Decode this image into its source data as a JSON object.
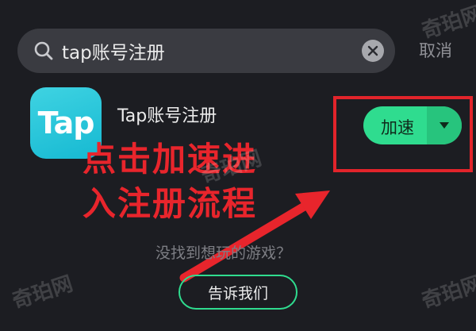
{
  "search": {
    "value": "tap账号注册",
    "cancel_label": "取消"
  },
  "app": {
    "icon_text": "Tap",
    "name": "Tap账号注册",
    "accelerate_label": "加速"
  },
  "annotation": {
    "line1": "点击加速进",
    "line2": "入注册流程"
  },
  "not_found": {
    "text": "没找到想玩的游戏？",
    "button_label": "告诉我们"
  },
  "watermark": {
    "text": "奇珀网"
  },
  "colors": {
    "background": "#1c1d22",
    "accent_green": "#2fdc8f",
    "annotation_red": "#e8252c",
    "app_icon_cyan": "#16b9d2"
  },
  "icons": {
    "search": "search-icon",
    "clear": "close-circle-icon",
    "dropdown": "caret-down-icon",
    "arrow": "arrow-up-right-icon"
  }
}
